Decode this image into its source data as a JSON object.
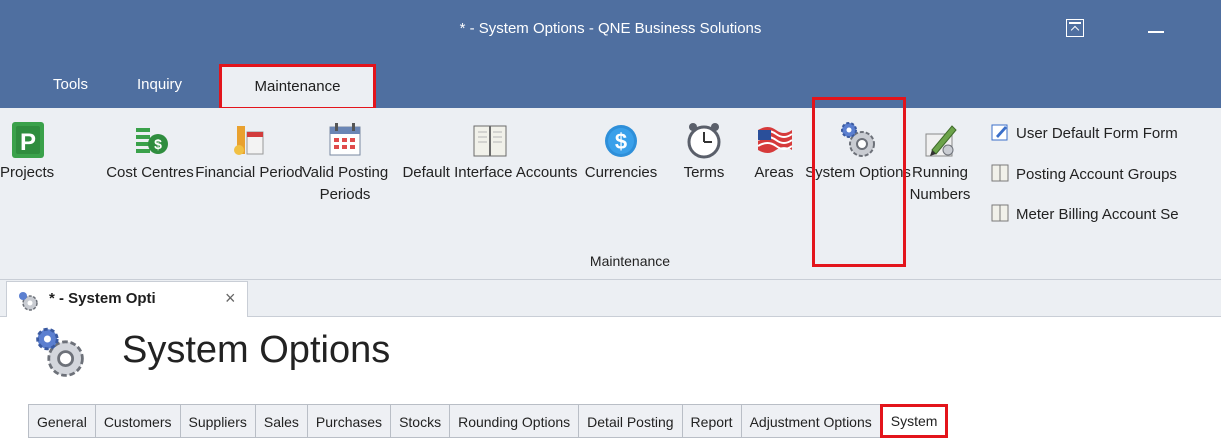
{
  "window": {
    "title": "* - System Options - QNE Business Solutions"
  },
  "ribbon": {
    "tabs": [
      "Tools",
      "Inquiry"
    ],
    "active_tab": "Maintenance",
    "buttons": [
      {
        "label": "Projects",
        "icon": "projects-icon"
      },
      {
        "label": "Cost Centres",
        "icon": "cost-centres-icon"
      },
      {
        "label": "Financial Period",
        "icon": "financial-period-icon"
      },
      {
        "label": "Valid Posting Periods",
        "icon": "calendar-icon"
      },
      {
        "label": "Default Interface Accounts",
        "icon": "book-icon"
      },
      {
        "label": "Currencies",
        "icon": "dollar-icon"
      },
      {
        "label": "Terms",
        "icon": "alarm-clock-icon"
      },
      {
        "label": "Areas",
        "icon": "flag-icon"
      },
      {
        "label": "System Options",
        "icon": "gears-icon"
      },
      {
        "label": "Running Numbers",
        "icon": "pencil-icon"
      }
    ],
    "small_buttons": [
      {
        "label": "User Default Form Form",
        "icon": "edit-form-icon"
      },
      {
        "label": "Posting Account Groups",
        "icon": "book-small-icon"
      },
      {
        "label": "Meter Billing Account Se",
        "icon": "book-small-icon"
      }
    ],
    "group_label": "Maintenance"
  },
  "document_tab": {
    "label": "* - System Opti",
    "close": "×"
  },
  "page": {
    "title": "System Options"
  },
  "option_tabs": [
    "General",
    "Customers",
    "Suppliers",
    "Sales",
    "Purchases",
    "Stocks",
    "Rounding Options",
    "Detail Posting",
    "Report",
    "Adjustment Options",
    "System"
  ],
  "colors": {
    "titlebar": "#4f6fa0",
    "ribbon": "#eceff3",
    "highlight": "#e3141b"
  }
}
